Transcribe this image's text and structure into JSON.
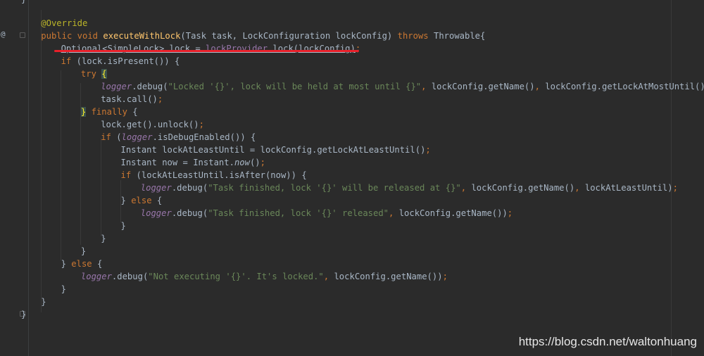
{
  "editor": {
    "gutter_marker": "@",
    "top_fragment": "}",
    "lines": [
      {
        "indent": 1,
        "tokens": [
          {
            "t": "ann",
            "v": "@Override"
          }
        ]
      },
      {
        "indent": 1,
        "tokens": [
          {
            "t": "kw",
            "v": "public void "
          },
          {
            "t": "fn",
            "v": "executeWithLock"
          },
          {
            "t": "plain",
            "v": "(Task task, LockConfiguration lockConfig) "
          },
          {
            "t": "kw",
            "v": "throws "
          },
          {
            "t": "plain",
            "v": "Throwable{"
          }
        ]
      },
      {
        "indent": 2,
        "tokens": [
          {
            "t": "plain",
            "v": "Optional<SimpleLock> lock = "
          },
          {
            "t": "fld-plain",
            "v": "lockProvider"
          },
          {
            "t": "plain",
            "v": ".lock(lockConfig)"
          },
          {
            "t": "kw",
            "v": ";"
          }
        ]
      },
      {
        "indent": 2,
        "tokens": [
          {
            "t": "kw",
            "v": "if "
          },
          {
            "t": "plain",
            "v": "(lock.isPresent()) {"
          }
        ]
      },
      {
        "indent": 3,
        "tokens": [
          {
            "t": "kw",
            "v": "try "
          },
          {
            "t": "brace",
            "v": "{"
          }
        ]
      },
      {
        "indent": 4,
        "tokens": [
          {
            "t": "fld",
            "v": "logger"
          },
          {
            "t": "plain",
            "v": ".debug("
          },
          {
            "t": "str",
            "v": "\"Locked '{}', lock will be held at most until {}\""
          },
          {
            "t": "kw",
            "v": ", "
          },
          {
            "t": "plain",
            "v": "lockConfig.getName()"
          },
          {
            "t": "kw",
            "v": ", "
          },
          {
            "t": "plain",
            "v": "lockConfig.getLockAtMostUntil())"
          },
          {
            "t": "kw",
            "v": ";"
          }
        ]
      },
      {
        "indent": 4,
        "tokens": [
          {
            "t": "plain",
            "v": "task.call()"
          },
          {
            "t": "kw",
            "v": ";"
          }
        ]
      },
      {
        "indent": 3,
        "tokens": [
          {
            "t": "brace",
            "v": "}"
          },
          {
            "t": "kw",
            "v": " finally "
          },
          {
            "t": "plain",
            "v": "{"
          }
        ]
      },
      {
        "indent": 4,
        "tokens": [
          {
            "t": "plain",
            "v": "lock.get().unlock()"
          },
          {
            "t": "kw",
            "v": ";"
          }
        ]
      },
      {
        "indent": 4,
        "tokens": [
          {
            "t": "kw",
            "v": "if "
          },
          {
            "t": "plain",
            "v": "("
          },
          {
            "t": "fld",
            "v": "logger"
          },
          {
            "t": "plain",
            "v": ".isDebugEnabled()) {"
          }
        ]
      },
      {
        "indent": 5,
        "tokens": [
          {
            "t": "plain",
            "v": "Instant lockAtLeastUntil = lockConfig.getLockAtLeastUntil()"
          },
          {
            "t": "kw",
            "v": ";"
          }
        ]
      },
      {
        "indent": 5,
        "tokens": [
          {
            "t": "plain",
            "v": "Instant now = Instant."
          },
          {
            "t": "ital",
            "v": "now"
          },
          {
            "t": "plain",
            "v": "()"
          },
          {
            "t": "kw",
            "v": ";"
          }
        ]
      },
      {
        "indent": 5,
        "tokens": [
          {
            "t": "kw",
            "v": "if "
          },
          {
            "t": "plain",
            "v": "(lockAtLeastUntil.isAfter(now)) {"
          }
        ]
      },
      {
        "indent": 6,
        "tokens": [
          {
            "t": "fld",
            "v": "logger"
          },
          {
            "t": "plain",
            "v": ".debug("
          },
          {
            "t": "str",
            "v": "\"Task finished, lock '{}' will be released at {}\""
          },
          {
            "t": "kw",
            "v": ", "
          },
          {
            "t": "plain",
            "v": "lockConfig.getName()"
          },
          {
            "t": "kw",
            "v": ", "
          },
          {
            "t": "plain",
            "v": "lockAtLeastUntil)"
          },
          {
            "t": "kw",
            "v": ";"
          }
        ]
      },
      {
        "indent": 5,
        "tokens": [
          {
            "t": "plain",
            "v": "} "
          },
          {
            "t": "kw",
            "v": "else "
          },
          {
            "t": "plain",
            "v": "{"
          }
        ]
      },
      {
        "indent": 6,
        "tokens": [
          {
            "t": "fld",
            "v": "logger"
          },
          {
            "t": "plain",
            "v": ".debug("
          },
          {
            "t": "str",
            "v": "\"Task finished, lock '{}' released\""
          },
          {
            "t": "kw",
            "v": ", "
          },
          {
            "t": "plain",
            "v": "lockConfig.getName())"
          },
          {
            "t": "kw",
            "v": ";"
          }
        ]
      },
      {
        "indent": 5,
        "tokens": [
          {
            "t": "plain",
            "v": "}"
          }
        ]
      },
      {
        "indent": 4,
        "tokens": [
          {
            "t": "plain",
            "v": "}"
          }
        ]
      },
      {
        "indent": 3,
        "tokens": [
          {
            "t": "plain",
            "v": "}"
          }
        ]
      },
      {
        "indent": 2,
        "tokens": [
          {
            "t": "plain",
            "v": "} "
          },
          {
            "t": "kw",
            "v": "else "
          },
          {
            "t": "plain",
            "v": "{"
          }
        ]
      },
      {
        "indent": 3,
        "tokens": [
          {
            "t": "fld",
            "v": "logger"
          },
          {
            "t": "plain",
            "v": ".debug("
          },
          {
            "t": "str",
            "v": "\"Not executing '{}'. It's locked.\""
          },
          {
            "t": "kw",
            "v": ", "
          },
          {
            "t": "plain",
            "v": "lockConfig.getName())"
          },
          {
            "t": "kw",
            "v": ";"
          }
        ]
      },
      {
        "indent": 2,
        "tokens": [
          {
            "t": "plain",
            "v": "}"
          }
        ]
      },
      {
        "indent": 1,
        "tokens": [
          {
            "t": "plain",
            "v": "}"
          }
        ]
      },
      {
        "indent": 0,
        "tokens": [
          {
            "t": "plain",
            "v": "}"
          }
        ]
      }
    ]
  },
  "annotation": {
    "underline_color": "#e8202a",
    "underlined_line_index": 2
  },
  "watermark": "https://blog.csdn.net/waltonhuang",
  "colors": {
    "background": "#2b2b2b",
    "keyword": "#cc7832",
    "annotation": "#bbb529",
    "method": "#ffc66d",
    "string": "#6a8759",
    "field": "#9876aa",
    "text": "#a9b7c6"
  }
}
